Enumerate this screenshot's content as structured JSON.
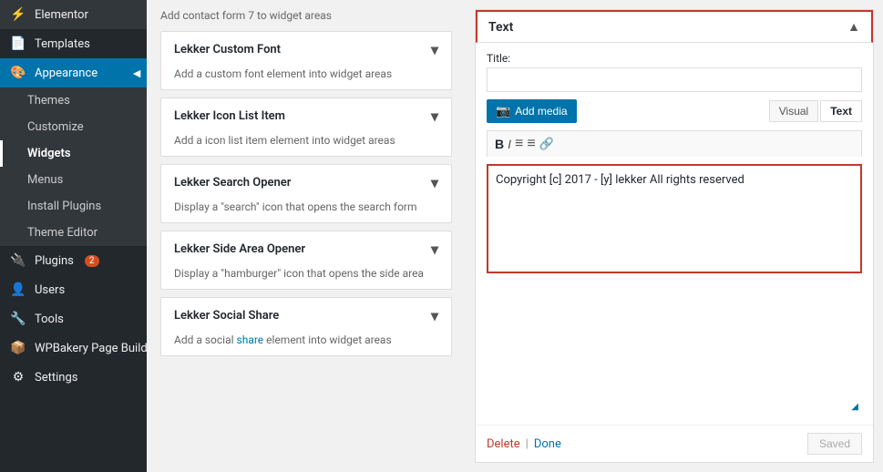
{
  "sidebar": {
    "items": [
      {
        "id": "elementor",
        "label": "Elementor",
        "icon": "⚡",
        "active": false
      },
      {
        "id": "templates",
        "label": "Templates",
        "icon": "📄",
        "active": false
      },
      {
        "id": "appearance",
        "label": "Appearance",
        "icon": "🎨",
        "active": true
      },
      {
        "id": "plugins",
        "label": "Plugins",
        "icon": "🔌",
        "active": false,
        "badge": "2"
      },
      {
        "id": "users",
        "label": "Users",
        "icon": "👤",
        "active": false
      },
      {
        "id": "tools",
        "label": "Tools",
        "icon": "🔧",
        "active": false
      },
      {
        "id": "wpbakery",
        "label": "WPBakery Page Builder",
        "icon": "📦",
        "active": false
      },
      {
        "id": "settings",
        "label": "Settings",
        "icon": "⚙",
        "active": false
      }
    ],
    "submenu": [
      {
        "id": "themes",
        "label": "Themes",
        "active": false
      },
      {
        "id": "customize",
        "label": "Customize",
        "active": false
      },
      {
        "id": "widgets",
        "label": "Widgets",
        "active": true
      },
      {
        "id": "menus",
        "label": "Menus",
        "active": false
      },
      {
        "id": "install-plugins",
        "label": "Install Plugins",
        "active": false
      },
      {
        "id": "theme-editor",
        "label": "Theme Editor",
        "active": false
      }
    ]
  },
  "widgets": [
    {
      "id": "lekker-custom-font",
      "title": "Lekker Custom Font",
      "description": "Add a custom font element into widget areas"
    },
    {
      "id": "lekker-icon-list",
      "title": "Lekker Icon List Item",
      "description": "Add a icon list item element into widget areas"
    },
    {
      "id": "lekker-search-opener",
      "title": "Lekker Search Opener",
      "description": "Display a \"search\" icon that opens the search form"
    },
    {
      "id": "lekker-side-area",
      "title": "Lekker Side Area Opener",
      "description": "Display a \"hamburger\" icon that opens the side area"
    },
    {
      "id": "lekker-social-share",
      "title": "Lekker Social Share",
      "description": "Add a social share element into widget areas"
    }
  ],
  "top_note": "Add contact form 7 to widget areas",
  "text_widget": {
    "tab_label": "Text",
    "title_label": "Title:",
    "title_placeholder": "",
    "add_media_label": "Add media",
    "visual_tab": "Visual",
    "text_tab": "Text",
    "content": "Copyright [c] 2017 - [y] lekker All rights reserved",
    "delete_link": "Delete",
    "done_link": "Done",
    "saved_button": "Saved"
  },
  "editor_toolbar": {
    "bold": "B",
    "italic": "I",
    "unordered_list": "≡",
    "ordered_list": "≡",
    "link": "🔗"
  }
}
